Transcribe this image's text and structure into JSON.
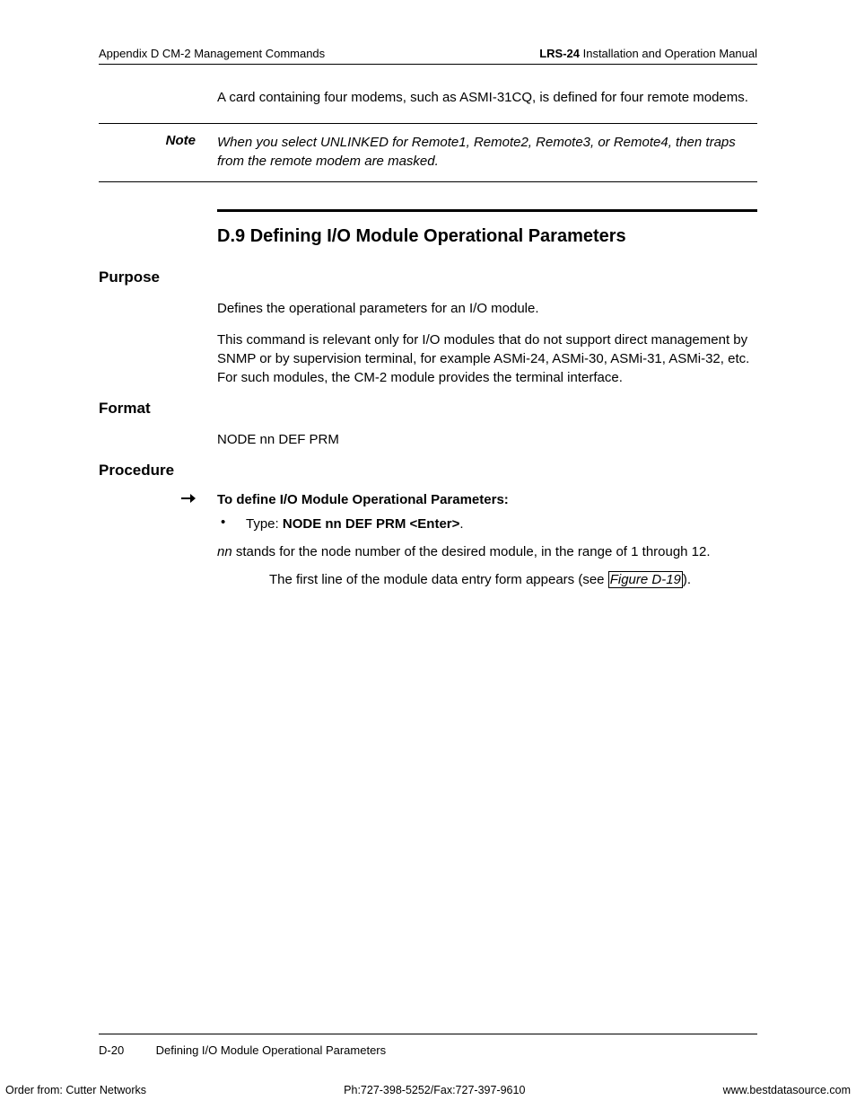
{
  "header": {
    "left": "Appendix D  CM-2 Management Commands",
    "right_bold": "LRS-24",
    "right_rest": " Installation and Operation Manual"
  },
  "intro": "A card containing four modems, such as ASMI-31CQ, is defined for four remote modems.",
  "note": {
    "label": "Note",
    "text": "When you select UNLINKED for Remote1, Remote2, Remote3, or Remote4, then traps from the remote modem are masked."
  },
  "section": {
    "number": "D.9",
    "title": "Defining I/O Module Operational Parameters"
  },
  "purpose": {
    "heading": "Purpose",
    "p1": "Defines the operational parameters for an I/O module.",
    "p2": "This command is relevant only for I/O modules that do not support direct management by SNMP or by supervision terminal, for example ASMi-24, ASMi-30, ASMi-31, ASMi-32, etc. For such modules, the CM-2 module provides the terminal interface."
  },
  "format": {
    "heading": "Format",
    "text": "NODE nn DEF PRM"
  },
  "procedure": {
    "heading": "Procedure",
    "lead": "To define I/O Module Operational Parameters:",
    "bullet_prefix": "Type: ",
    "bullet_cmd": "NODE nn DEF PRM <Enter>",
    "bullet_suffix": ".",
    "nn_ital": "nn",
    "nn_rest": " stands for the node number of the desired module, in the range of 1 through 12.",
    "result_pre": "The first line of the module data entry form appears (see ",
    "result_ref": "Figure D-19",
    "result_post": ")."
  },
  "footer": {
    "pagenum": "D-20",
    "title": "Defining I/O Module Operational Parameters"
  },
  "orderline": {
    "left": "Order from: Cutter Networks",
    "mid": "Ph:727-398-5252/Fax:727-397-9610",
    "right": "www.bestdatasource.com"
  }
}
